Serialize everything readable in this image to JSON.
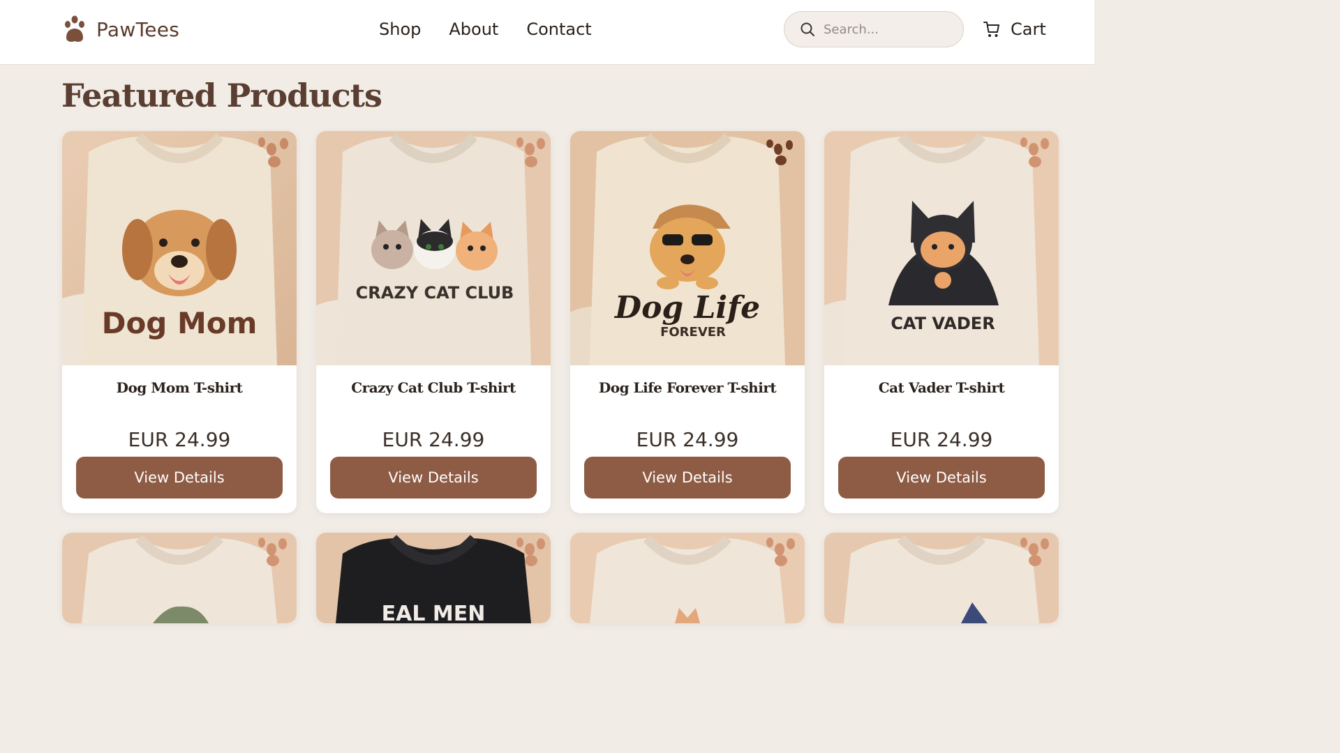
{
  "header": {
    "brand": "PawTees",
    "nav": [
      "Shop",
      "About",
      "Contact"
    ],
    "search_placeholder": "Search...",
    "cart_label": "Cart"
  },
  "main": {
    "title": "Featured Products",
    "products": [
      {
        "name": "Dog Mom T-shirt",
        "price": "EUR 24.99",
        "button": "View Details",
        "print_text": "Dog Mom",
        "shirt_color": "#efe3d2",
        "art": "dog"
      },
      {
        "name": "Crazy Cat Club T-shirt",
        "price": "EUR 24.99",
        "button": "View Details",
        "print_text": "CRAZY CAT CLUB",
        "shirt_color": "#ede4d7",
        "art": "cats"
      },
      {
        "name": "Dog Life Forever T-shirt",
        "price": "EUR 24.99",
        "button": "View Details",
        "print_text": "Dog Life",
        "print_subtext": "FOREVER",
        "shirt_color": "#f0e4d0",
        "art": "dog-glasses"
      },
      {
        "name": "Cat Vader T-shirt",
        "price": "EUR 24.99",
        "button": "View Details",
        "print_text": "CAT VADER",
        "shirt_color": "#efe5d8",
        "art": "cat-vader"
      }
    ],
    "second_row": [
      {
        "shirt_color": "#efe5d8",
        "art": "green-cap"
      },
      {
        "shirt_color": "#1e1e20",
        "print_text": "EAL MEN",
        "art": "text"
      },
      {
        "shirt_color": "#efe5d8",
        "art": "cat-ears"
      },
      {
        "shirt_color": "#efe5d8",
        "art": "wizard-hat"
      }
    ]
  },
  "colors": {
    "accent": "#8e5b45",
    "brand": "#5a3c2e",
    "background": "#f2ece6"
  }
}
